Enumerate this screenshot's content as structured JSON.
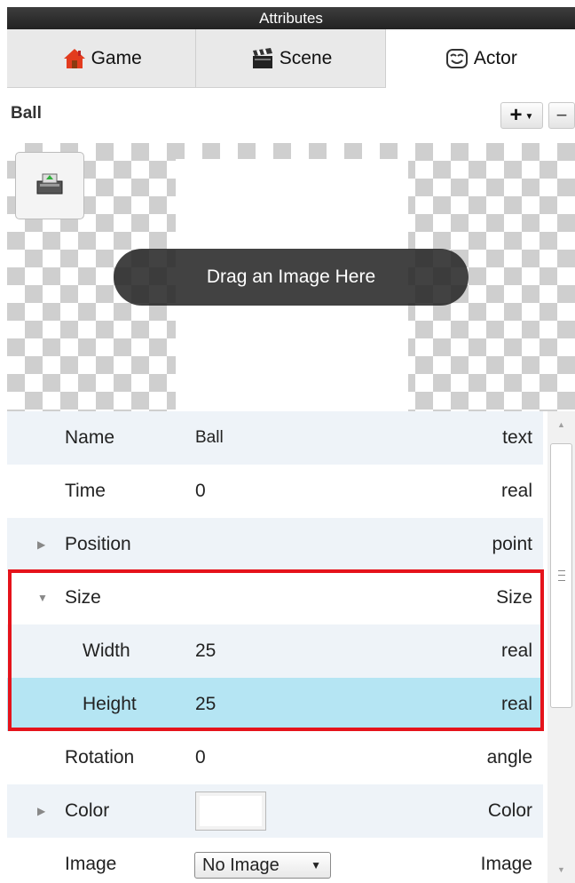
{
  "window": {
    "title": "Attributes"
  },
  "tabs": [
    {
      "label": "Game",
      "icon": "house-icon"
    },
    {
      "label": "Scene",
      "icon": "clapperboard-icon"
    },
    {
      "label": "Actor",
      "icon": "mask-icon",
      "active": true
    }
  ],
  "actor": {
    "name": "Ball",
    "add_label": "+",
    "remove_label": "−"
  },
  "image_area": {
    "drag_label": "Drag an Image Here",
    "open_icon": "open-image-icon"
  },
  "properties": [
    {
      "label": "Name",
      "value": "Ball",
      "type": "text"
    },
    {
      "label": "Time",
      "value": "0",
      "type": "real"
    },
    {
      "label": "Position",
      "value": "",
      "type": "point",
      "expandable": "collapsed"
    },
    {
      "label": "Size",
      "value": "",
      "type": "Size",
      "expandable": "expanded"
    },
    {
      "label": "Width",
      "value": "25",
      "type": "real"
    },
    {
      "label": "Height",
      "value": "25",
      "type": "real",
      "selected": true
    },
    {
      "label": "Rotation",
      "value": "0",
      "type": "angle"
    },
    {
      "label": "Color",
      "value": "",
      "type": "Color",
      "expandable": "collapsed",
      "swatch": "#ffffff"
    },
    {
      "label": "Image",
      "value": "No Image",
      "type": "Image",
      "control": "select"
    }
  ],
  "colors": {
    "highlight": "#e5131b",
    "selected_row": "#b5e5f3",
    "alt_row": "#eef3f8"
  }
}
